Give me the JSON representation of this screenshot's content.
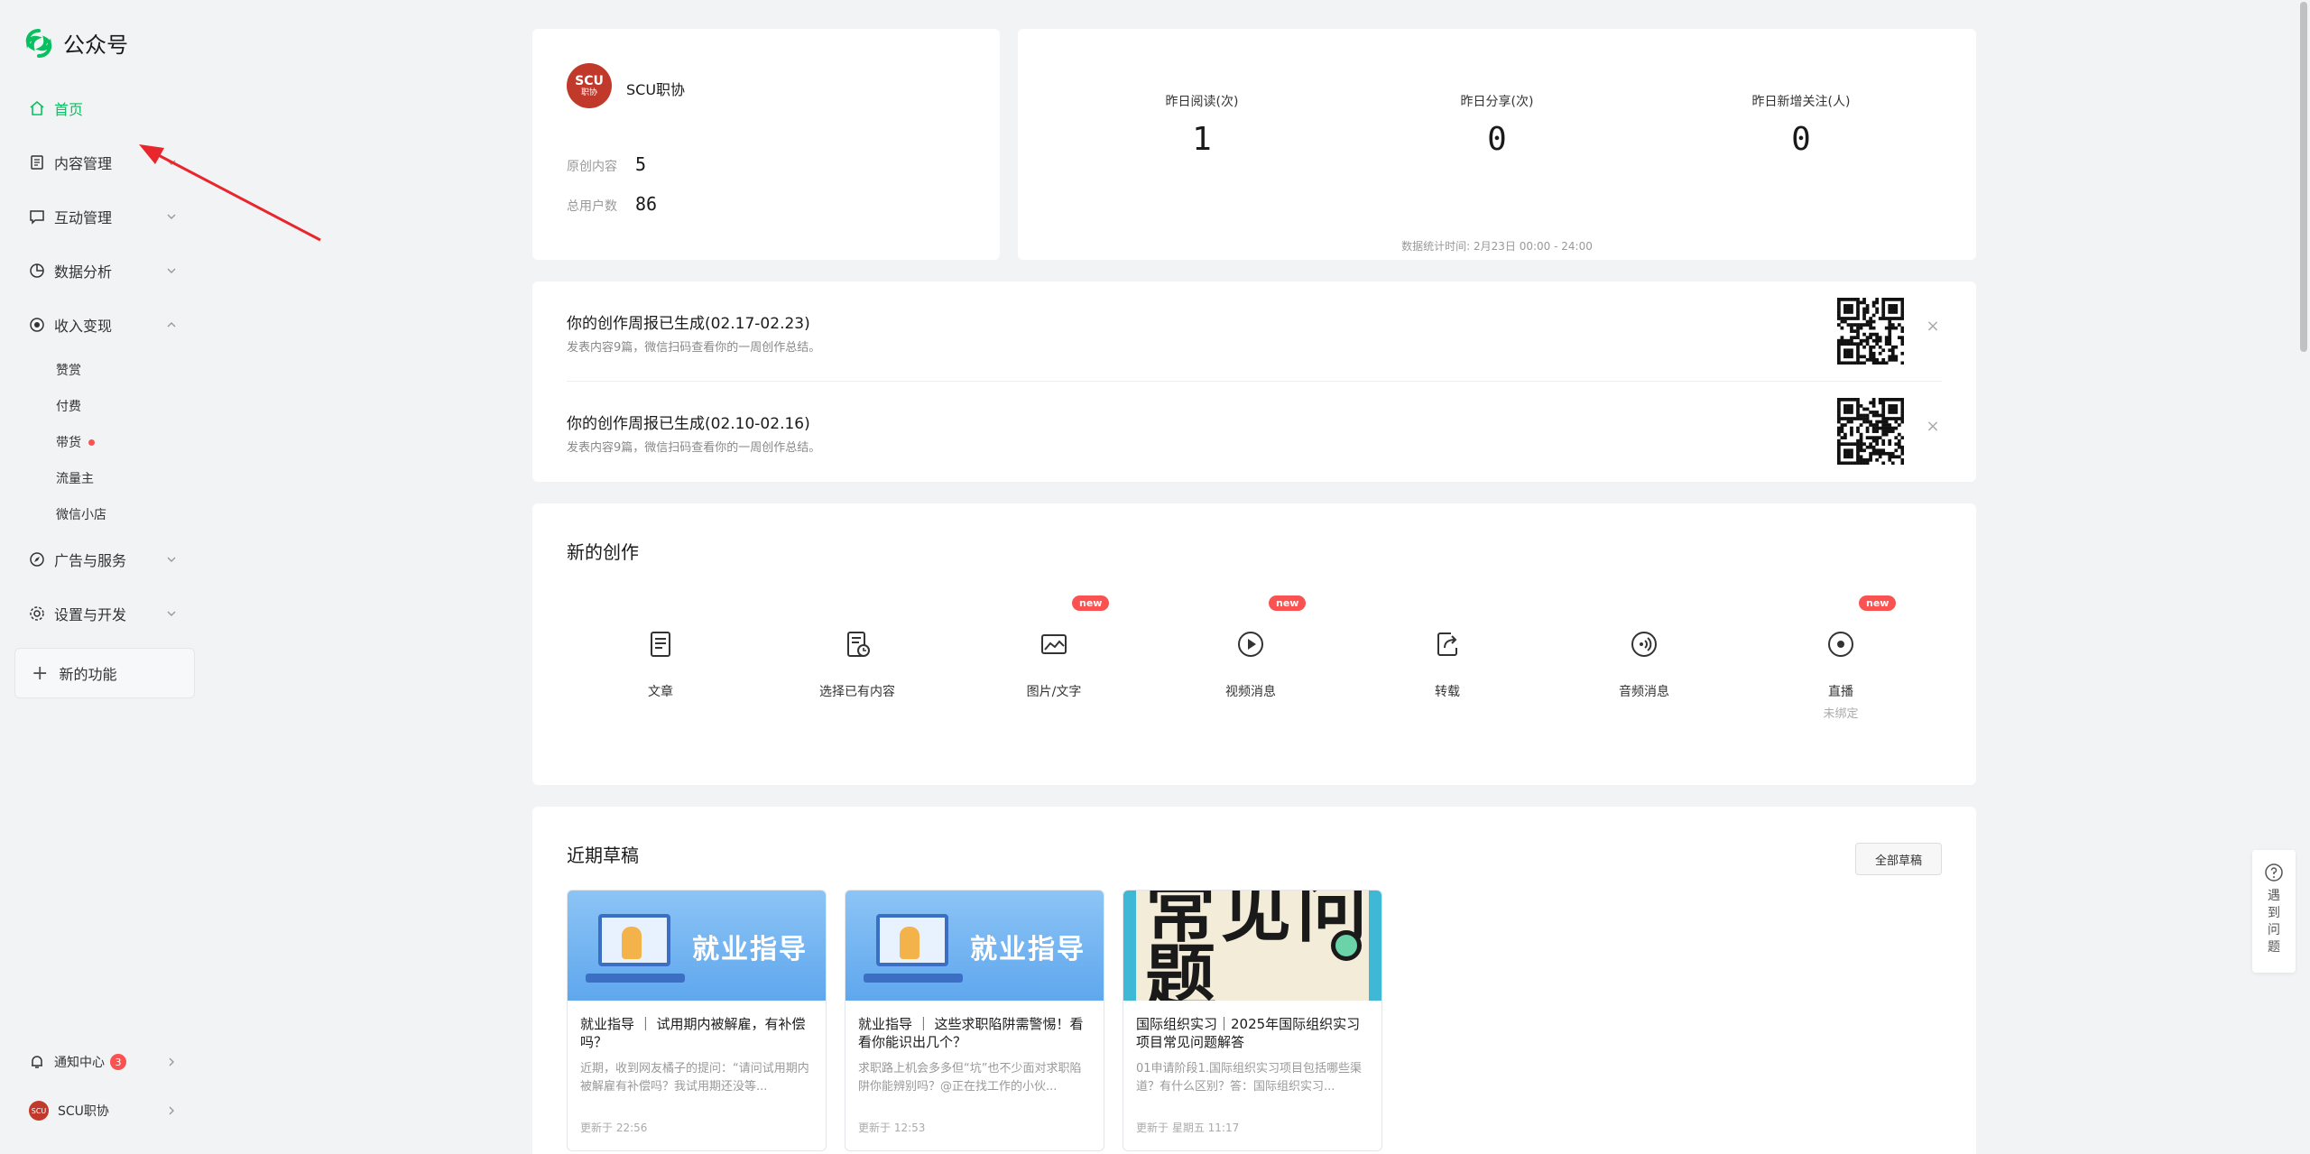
{
  "brand": {
    "title": "公众号"
  },
  "nav": {
    "home": "首页",
    "content": "内容管理",
    "interact": "互动管理",
    "analytics": "数据分析",
    "revenue": "收入变现",
    "revenue_sub": [
      "赞赏",
      "付费",
      "带货",
      "流量主",
      "微信小店"
    ],
    "ads": "广告与服务",
    "settings": "设置与开发",
    "new_feature": "新的功能"
  },
  "sidebar_bottom": {
    "notify": "通知中心",
    "notify_count": "3",
    "account": "SCU职协"
  },
  "account": {
    "name": "SCU职协",
    "avatar_text": "SCU",
    "avatar_sub": "职协",
    "original_label": "原创内容",
    "original_value": "5",
    "users_label": "总用户数",
    "users_value": "86"
  },
  "stats": {
    "items": [
      {
        "label": "昨日阅读(次)",
        "value": "1"
      },
      {
        "label": "昨日分享(次)",
        "value": "0"
      },
      {
        "label": "昨日新增关注(人)",
        "value": "0"
      }
    ],
    "note": "数据统计时间: 2月23日 00:00 - 24:00"
  },
  "reports": [
    {
      "title": "你的创作周报已生成(02.17-02.23)",
      "desc": "发表内容9篇，微信扫码查看你的一周创作总结。"
    },
    {
      "title": "你的创作周报已生成(02.10-02.16)",
      "desc": "发表内容9篇，微信扫码查看你的一周创作总结。"
    }
  ],
  "create": {
    "title": "新的创作",
    "items": [
      {
        "label": "文章",
        "sub": "",
        "tag": ""
      },
      {
        "label": "选择已有内容",
        "sub": "",
        "tag": ""
      },
      {
        "label": "图片/文字",
        "sub": "",
        "tag": "new"
      },
      {
        "label": "视频消息",
        "sub": "",
        "tag": "new"
      },
      {
        "label": "转载",
        "sub": "",
        "tag": ""
      },
      {
        "label": "音频消息",
        "sub": "",
        "tag": ""
      },
      {
        "label": "直播",
        "sub": "未绑定",
        "tag": "new"
      }
    ]
  },
  "drafts": {
    "title": "近期草稿",
    "all_label": "全部草稿",
    "items": [
      {
        "cover_text": "就业指导",
        "title": "就业指导 ｜ 试用期内被解雇，有补偿吗？",
        "excerpt": "近期，收到网友橘子的提问：“请问试用期内被解雇有补偿吗？我试用期还没等...",
        "time": "更新于 22:56"
      },
      {
        "cover_text": "就业指导",
        "title": "就业指导 ｜ 这些求职陷阱需警惕！看看你能识出几个？",
        "excerpt": "求职路上机会多多但“坑”也不少面对求职陷阱你能辨别吗？@正在找工作的小伙...",
        "time": "更新于 12:53"
      },
      {
        "cover_text": "常见问题",
        "title": "国际组织实习｜2025年国际组织实习项目常见问题解答",
        "excerpt": "01申请阶段1.国际组织实习项目包括哪些渠道？有什么区别？答：国际组织实习...",
        "time": "更新于 星期五 11:17"
      }
    ]
  },
  "help": {
    "label": "遇到问题"
  },
  "colors": {
    "accent": "#07c160",
    "badge": "#fa5151",
    "arrow": "#e8262b"
  }
}
